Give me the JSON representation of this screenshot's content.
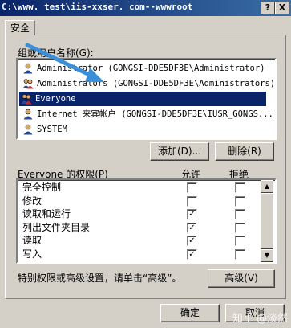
{
  "window": {
    "title": "C:\\www. test\\iis-xxser. com--wwwroot",
    "help_button": "?",
    "close_button": "X"
  },
  "tab": {
    "label": "安全"
  },
  "users": {
    "label": "组或用户名称(G):",
    "items": [
      {
        "text": "Administrator (GONGSI-DDE5DF3E\\Administrator)",
        "selected": false,
        "icon": "user-icon"
      },
      {
        "text": "Administrators (GONGSI-DDE5DF3E\\Administrators)",
        "selected": false,
        "icon": "group-icon"
      },
      {
        "text": "Everyone",
        "selected": true,
        "icon": "group-icon"
      },
      {
        "text": "Internet 来宾帐户 (GONGSI-DDE5DF3E\\IUSR_GONGS...",
        "selected": false,
        "icon": "user-icon"
      },
      {
        "text": "SYSTEM",
        "selected": false,
        "icon": "user-icon"
      }
    ]
  },
  "buttons": {
    "add": "添加(D)...",
    "remove": "删除(R)",
    "advanced": "高级(V)",
    "ok": "确定",
    "cancel": "取消"
  },
  "permissions": {
    "label": "Everyone 的权限(P)",
    "allow_header": "允许",
    "deny_header": "拒绝",
    "rows": [
      {
        "name": "完全控制",
        "allow": false,
        "deny": false
      },
      {
        "name": "修改",
        "allow": false,
        "deny": false
      },
      {
        "name": "读取和运行",
        "allow": true,
        "deny": false
      },
      {
        "name": "列出文件夹目录",
        "allow": true,
        "deny": false
      },
      {
        "name": "读取",
        "allow": true,
        "deny": false
      },
      {
        "name": "写入",
        "allow": true,
        "deny": false
      }
    ]
  },
  "advanced_note": "特别权限或高级设置，请单击“高级”。",
  "watermark": "知乎 @淡然",
  "colors": {
    "selection": "#0a246a",
    "dialog_bg": "#d4d0c8",
    "arrow": "#3b8fd8"
  }
}
